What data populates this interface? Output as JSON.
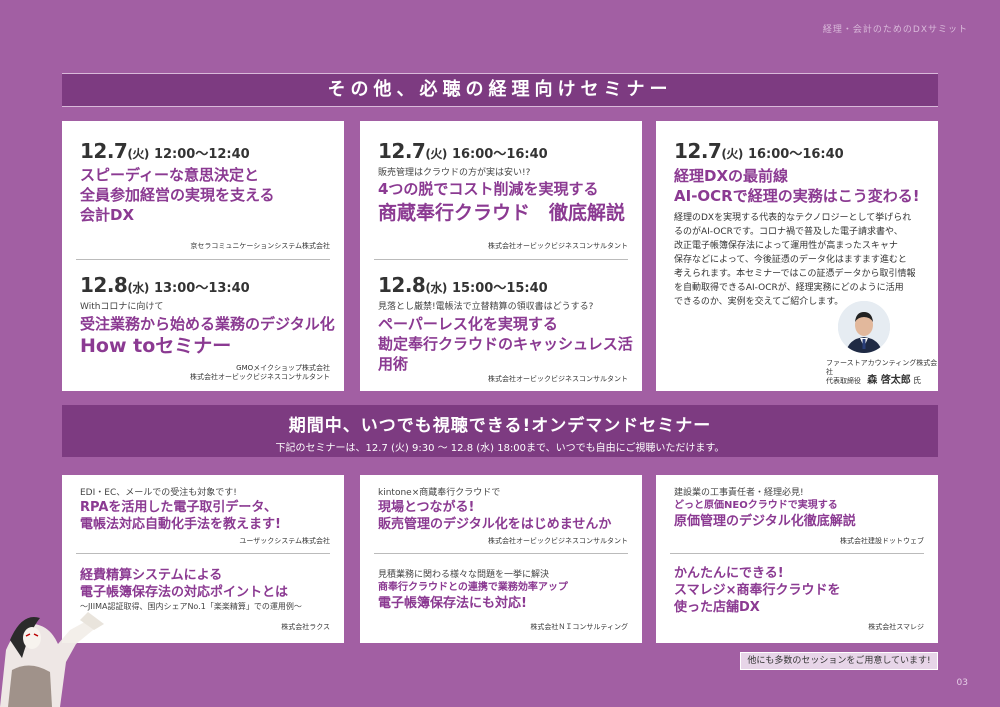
{
  "header": {
    "tag": "経理・会計のためのDXサミット"
  },
  "section1": {
    "title": "その他、必聴の経理向けセミナー"
  },
  "card1": {
    "top": {
      "date": "12.7",
      "day": "(火)",
      "time": "12:00〜12:40",
      "title": [
        "スピーディーな意思決定と",
        "全員参加経営の実現を支える",
        "会計DX"
      ],
      "company": "京セラコミュニケーションシステム株式会社"
    },
    "bottom": {
      "date": "12.8",
      "day": "(水)",
      "time": "13:00〜13:40",
      "sub": "Withコロナに向けて",
      "title": "受注業務から始める業務のデジタル化",
      "title_big": "How toセミナー",
      "company": [
        "GMOメイクショップ株式会社",
        "株式会社オービックビジネスコンサルタント"
      ]
    }
  },
  "card2": {
    "top": {
      "date": "12.7",
      "day": "(火)",
      "time": "16:00〜16:40",
      "sub": "販売管理はクラウドの方が実は安い!?",
      "title": "4つの脱でコスト削減を実現する",
      "title_big": "商蔵奉行クラウド　徹底解説",
      "company": "株式会社オービックビジネスコンサルタント"
    },
    "bottom": {
      "date": "12.8",
      "day": "(水)",
      "time": "15:00〜15:40",
      "sub": "見落とし厳禁!電帳法で立替精算の領収書はどうする?",
      "title": [
        "ペーパーレス化を実現する",
        "勘定奉行クラウドのキャッシュレス活用術"
      ],
      "company": "株式会社オービックビジネスコンサルタント"
    }
  },
  "card3": {
    "date": "12.7",
    "day": "(火)",
    "time": "16:00〜16:40",
    "title": [
      "経理DXの最前線",
      "AI-OCRで経理の実務はこう変わる!"
    ],
    "body": [
      "経理のDXを実現する代表的なテクノロジーとして挙げられ",
      "るのがAI-OCRです。コロナ禍で普及した電子請求書や、",
      "改正電子帳簿保存法によって運用性が高まったスキャナ",
      "保存などによって、今後証憑のデータ化はますます進むと",
      "考えられます。本セミナーではこの証憑データから取引情報",
      "を自動取得できるAI-OCRが、経理実務にどのように活用",
      "できるのか、実例を交えてご紹介します。"
    ],
    "company": "ファーストアカウンティング株式会社",
    "role": "代表取締役",
    "name": "森 啓太郎",
    "suffix": "氏"
  },
  "section2": {
    "title": "期間中、いつでも視聴できる!オンデマンドセミナー",
    "subtitle": "下記のセミナーは、12.7 (火) 9:30 〜 12.8 (水) 18:00まで、いつでも自由にご視聴いただけます。"
  },
  "od1": {
    "top": {
      "sub": "EDI・EC、メールでの受注も対象です!",
      "title": [
        "RPAを活用した電子取引データ、",
        "電帳法対応自動化手法を教えます!"
      ],
      "company": "ユーザックシステム株式会社"
    },
    "bottom": {
      "title": [
        "経費精算システムによる",
        "電子帳簿保存法の対応ポイントとは"
      ],
      "sub": "〜JIIMA認証取得、国内シェアNo.1「楽楽精算」での運用例〜",
      "company": "株式会社ラクス"
    }
  },
  "od2": {
    "top": {
      "sub": "kintone×商蔵奉行クラウドで",
      "title": [
        "現場とつながる!",
        "販売管理のデジタル化をはじめませんか"
      ],
      "company": "株式会社オービックビジネスコンサルタント"
    },
    "bottom": {
      "sub": "見積業務に関わる様々な問題を一挙に解決",
      "title_small": "商奉行クラウドとの連携で業務効率アップ",
      "title": "電子帳簿保存法にも対応!",
      "company": "株式会社ＮＩコンサルティング"
    }
  },
  "od3": {
    "top": {
      "sub": "建設業の工事責任者・経理必見!",
      "title_small": "どっと原価NEOクラウドで実現する",
      "title": "原価管理のデジタル化徹底解説",
      "company": "株式会社建設ドットウェブ"
    },
    "bottom": {
      "title": [
        "かんたんにできる!",
        "スマレジ×商奉行クラウドを",
        "使った店舗DX"
      ],
      "company": "株式会社スマレジ"
    }
  },
  "footer": {
    "note": "他にも多数のセッションをご用意しています!",
    "page": "03"
  }
}
